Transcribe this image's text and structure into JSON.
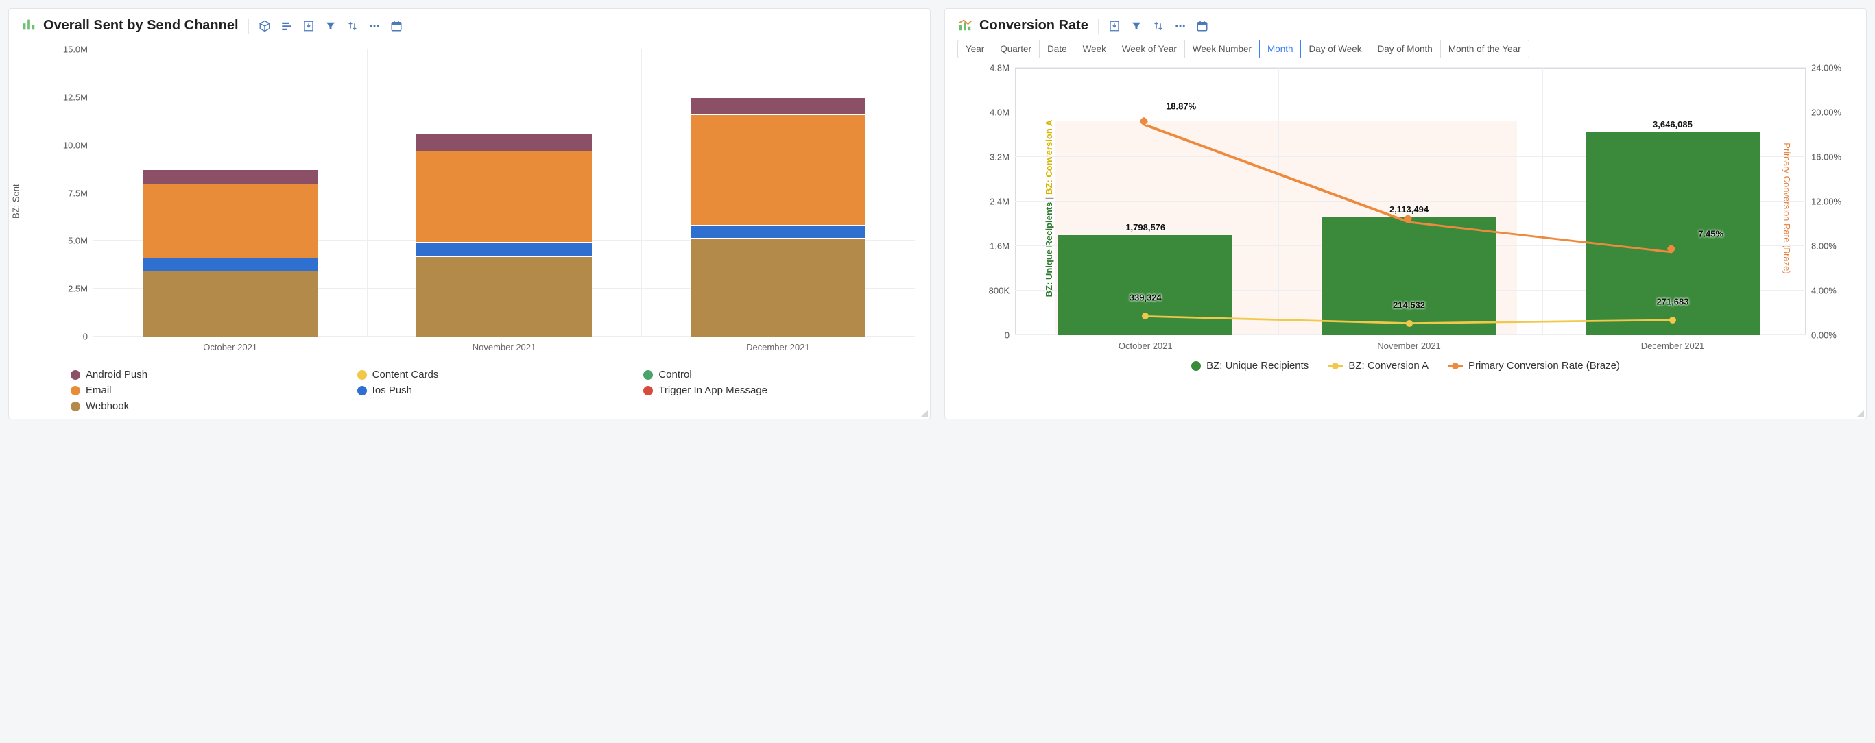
{
  "panels": {
    "left": {
      "title": "Overall Sent by Send Channel",
      "y_axis_label": "BZ: Sent",
      "x_ticks": [
        "October 2021",
        "November 2021",
        "December 2021"
      ],
      "y_ticks": [
        "0",
        "2.5M",
        "5.0M",
        "7.5M",
        "10.0M",
        "12.5M",
        "15.0M"
      ],
      "legend": [
        "Android Push",
        "Content Cards",
        "Control",
        "Email",
        "Ios Push",
        "Trigger In App Message",
        "Webhook"
      ]
    },
    "right": {
      "title": "Conversion Rate",
      "time_grain_options": [
        "Year",
        "Quarter",
        "Date",
        "Week",
        "Week of Year",
        "Week Number",
        "Month",
        "Day of Week",
        "Day of Month",
        "Month of the Year"
      ],
      "time_grain_selected": "Month",
      "x_ticks": [
        "October 2021",
        "November 2021",
        "December 2021"
      ],
      "y_left_ticks": [
        "0",
        "800K",
        "1.6M",
        "2.4M",
        "3.2M",
        "4.0M",
        "4.8M"
      ],
      "y_right_ticks": [
        "0.00%",
        "4.00%",
        "8.00%",
        "12.00%",
        "16.00%",
        "20.00%",
        "24.00%"
      ],
      "y_left_label_a": "BZ: Unique Recipients",
      "y_left_label_b": "BZ: Conversion A",
      "y_right_label": "Primary Conversion Rate (Braze)",
      "bar_labels": [
        "1,798,576",
        "2,113,494",
        "3,646,085"
      ],
      "conv_a_labels": [
        "339,324",
        "214,532",
        "271,683"
      ],
      "rate_labels": [
        "18.87%",
        "",
        "7.45%"
      ],
      "legend": [
        "BZ: Unique Recipients",
        "BZ: Conversion A",
        "Primary Conversion Rate (Braze)"
      ]
    }
  },
  "colors": {
    "android_push": "#8b4f66",
    "content_cards": "#f2c84b",
    "control": "#4aa36b",
    "email": "#e98c3a",
    "ios_push": "#2f6fd0",
    "trigger_iam": "#d84b3b",
    "webhook": "#b48a4a",
    "recipients": "#3b8a3b",
    "conv_a_line": "#f2c84b",
    "rate_line": "#ee8a3e"
  },
  "chart_data": [
    {
      "type": "bar",
      "stacked": true,
      "title": "Overall Sent by Send Channel",
      "xlabel": "",
      "ylabel": "BZ: Sent",
      "ylim": [
        0,
        15000000
      ],
      "categories": [
        "October 2021",
        "November 2021",
        "December 2021"
      ],
      "series": [
        {
          "name": "Webhook",
          "values": [
            3450000,
            4200000,
            5150000
          ]
        },
        {
          "name": "Ios Push",
          "values": [
            650000,
            750000,
            700000
          ]
        },
        {
          "name": "Email",
          "values": [
            3900000,
            4750000,
            5750000
          ]
        },
        {
          "name": "Android Push",
          "values": [
            750000,
            900000,
            900000
          ]
        },
        {
          "name": "Content Cards",
          "values": [
            0,
            0,
            0
          ]
        },
        {
          "name": "Control",
          "values": [
            0,
            0,
            0
          ]
        },
        {
          "name": "Trigger In App Message",
          "values": [
            0,
            0,
            0
          ]
        }
      ]
    },
    {
      "type": "bar+line",
      "title": "Conversion Rate",
      "xlabel": "",
      "categories": [
        "October 2021",
        "November 2021",
        "December 2021"
      ],
      "y_left": {
        "label": "BZ: Unique Recipients | BZ: Conversion A",
        "lim": [
          0,
          4800000
        ]
      },
      "y_right": {
        "label": "Primary Conversion Rate (Braze)",
        "lim": [
          0,
          24
        ]
      },
      "series": [
        {
          "name": "BZ: Unique Recipients",
          "axis": "left",
          "kind": "bar",
          "values": [
            1798576,
            2113494,
            3646085
          ]
        },
        {
          "name": "BZ: Conversion A",
          "axis": "left",
          "kind": "line",
          "values": [
            339324,
            214532,
            271683
          ]
        },
        {
          "name": "Primary Conversion Rate (Braze)",
          "axis": "right",
          "kind": "line",
          "values": [
            18.87,
            10.15,
            7.45
          ]
        }
      ]
    }
  ]
}
